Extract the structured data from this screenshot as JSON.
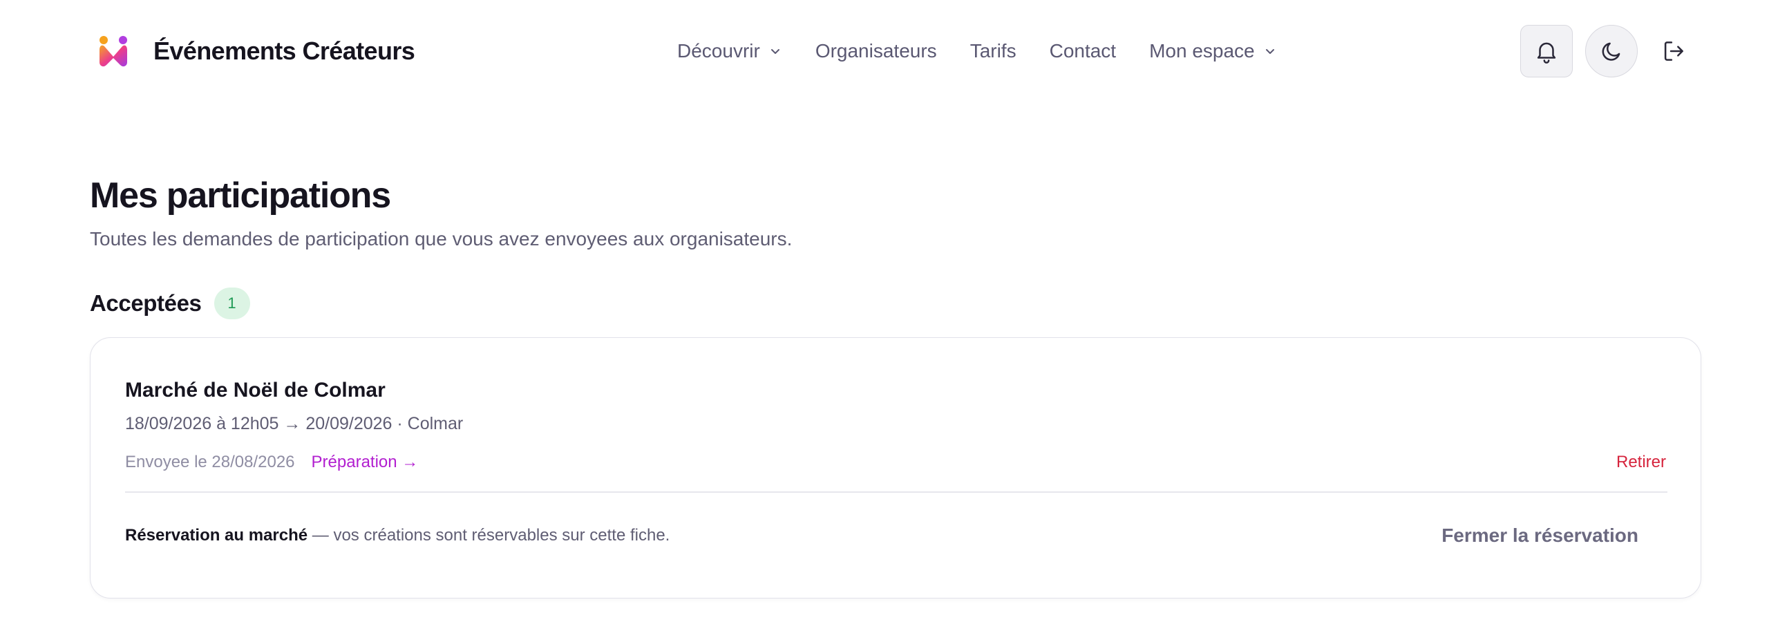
{
  "header": {
    "brand": "Événements Créateurs",
    "nav": [
      {
        "label": "Découvrir",
        "has_dropdown": true
      },
      {
        "label": "Organisateurs",
        "has_dropdown": false
      },
      {
        "label": "Tarifs",
        "has_dropdown": false
      },
      {
        "label": "Contact",
        "has_dropdown": false
      },
      {
        "label": "Mon espace",
        "has_dropdown": true
      }
    ],
    "icons": [
      "bell-icon",
      "moon-icon",
      "logout-icon"
    ]
  },
  "page": {
    "title": "Mes participations",
    "subtitle": "Toutes les demandes de participation que vous avez envoyees aux organisateurs."
  },
  "section": {
    "title": "Acceptées",
    "count": "1"
  },
  "card": {
    "event_title": "Marché de Noël de Colmar",
    "meta": "18/09/2026 à 12h05 → 20/09/2026 · Colmar",
    "sent": "Envoyee le 28/08/2026",
    "prep_link": "Préparation →",
    "withdraw": "Retirer",
    "reservation_strong": "Réservation au marché",
    "reservation_rest": " — vos créations sont réservables sur cette fiche.",
    "close_button": "Fermer la réservation"
  },
  "colors": {
    "accent_magenta": "#b21fd0",
    "danger": "#d6243d",
    "success_badge_bg": "#dcf4e4",
    "success_badge_text": "#1f9a55"
  }
}
